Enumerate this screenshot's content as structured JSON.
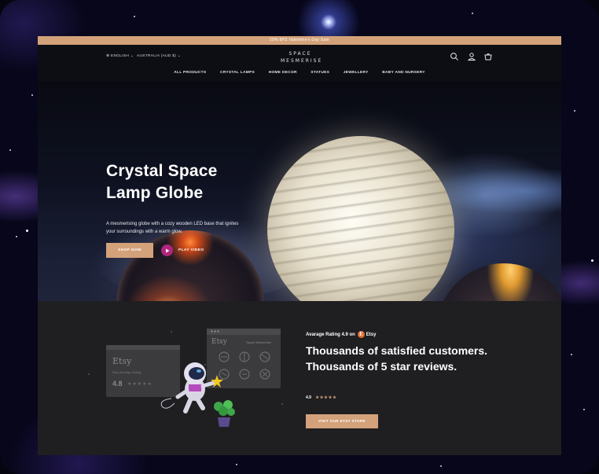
{
  "announcement": "20% 8PS Valentine's Day Sale",
  "header": {
    "language": "⊕ ENGLISH",
    "currency": "AUSTRALIA (AUD $)",
    "logo_line1": "SPACE",
    "logo_line2": "MESMERISE"
  },
  "nav": {
    "items": [
      "ALL PRODUCTS",
      "CRYSTAL LAMPS",
      "HOME DECOR",
      "STATUES",
      "JEWELLERY",
      "BABY AND NURSERY"
    ]
  },
  "hero": {
    "title_line1": "Crystal Space",
    "title_line2": "Lamp Globe",
    "subtitle": "A mesmerising globe with a cozy wooden LED base that ignites your surroundings with a warm glow.",
    "shop_button": "SHOP NOW",
    "play_label": "PLAY VIDEO"
  },
  "reviews": {
    "average_prefix": "Avarage Rating 4.9 on",
    "etsy_badge": "E",
    "etsy_label": "Etsy",
    "headline": "Thousands of satisfied customers. Thousands of 5 star reviews.",
    "mini_rating": "4.9",
    "mini_stars": "★★★★★",
    "etsy_button": "VISIT OUR ETSY STORE",
    "card_left": {
      "brand": "Etsy",
      "caption": "Etsy Average Rating",
      "score": "4.8",
      "stars": "★★★★★"
    },
    "card_right": {
      "brand": "Etsy",
      "shop": "Space Mesmerise"
    }
  },
  "colors": {
    "accent": "#d3a27a",
    "play": "#b0257f",
    "etsy": "#e26a2c"
  }
}
